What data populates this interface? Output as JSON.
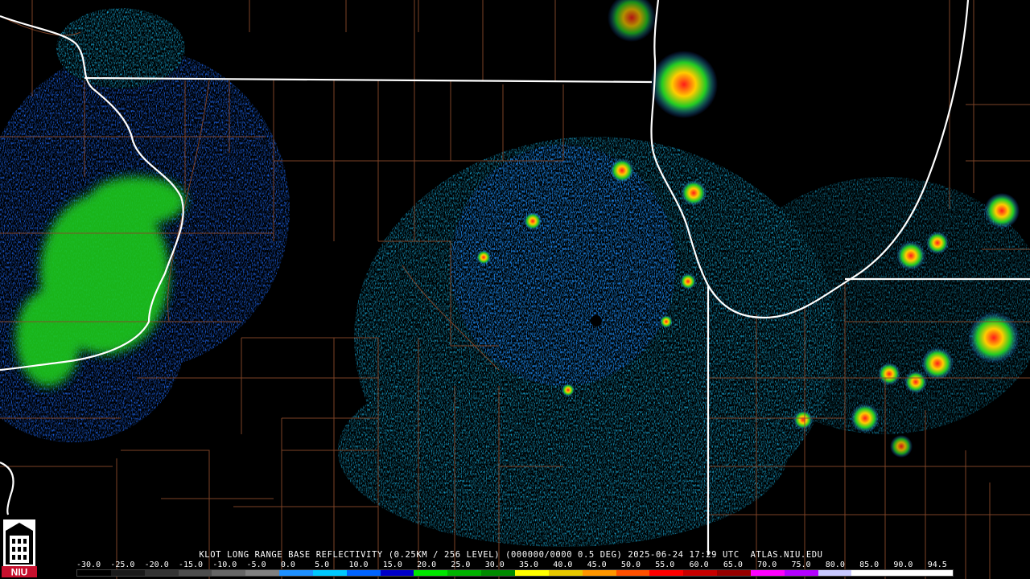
{
  "product": {
    "caption": "KLOT LONG RANGE BASE REFLECTIVITY (0.25KM / 256 LEVEL) (000000/0000 0.5 DEG) 2025-06-24 17:29 UTC  ATLAS.NIU.EDU"
  },
  "logo": {
    "text": "NIU",
    "colors": {
      "red": "#c8102e",
      "white": "#ffffff",
      "black": "#000000"
    }
  },
  "colorbar": {
    "labels": [
      "-30.0",
      "-25.0",
      "-20.0",
      "-15.0",
      "-10.0",
      "-5.0",
      "0.0",
      "5.0",
      "10.0",
      "15.0",
      "20.0",
      "25.0",
      "30.0",
      "35.0",
      "40.0",
      "45.0",
      "50.0",
      "55.0",
      "60.0",
      "65.0",
      "70.0",
      "75.0",
      "80.0",
      "85.0",
      "90.0",
      "94.5"
    ],
    "stops": [
      "#000000",
      "#1a1a1a",
      "#333333",
      "#4d4d4d",
      "#666666",
      "#808080",
      "#1e90ff",
      "#00c8ff",
      "#0064ff",
      "#0000c8",
      "#00e600",
      "#00b400",
      "#008c00",
      "#ffff00",
      "#e6c800",
      "#ff9600",
      "#ff5000",
      "#ff0000",
      "#c80000",
      "#960000",
      "#ff00ff",
      "#b400ff",
      "#c8c8ff",
      "#ffffff",
      "#ffffff",
      "#ffffff"
    ]
  },
  "map_colors": {
    "background": "#000000",
    "state_border": "#ffffff",
    "county_border": "#8b4a2b",
    "echo_light": "#16b4e6",
    "echo_medium": "#1e64ff",
    "echo_green": "#1ec81e",
    "echo_yellow": "#ffe600",
    "echo_red": "#ff2020",
    "radar_site": "#000000"
  }
}
